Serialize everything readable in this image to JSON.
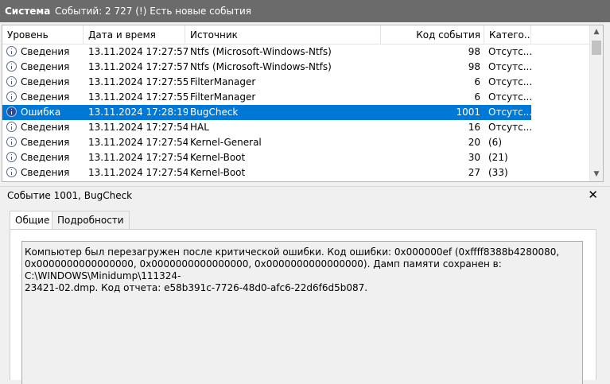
{
  "titlebar": {
    "title": "Система",
    "summary": "Событий: 2 727 (!) Есть новые события"
  },
  "columns": {
    "level": "Уровень",
    "datetime": "Дата и время",
    "source": "Источник",
    "event_id": "Код события",
    "category": "Катего..."
  },
  "rows": [
    {
      "level": "Сведения",
      "datetime": "13.11.2024 17:27:57",
      "source": "Ntfs (Microsoft-Windows-Ntfs)",
      "event_id": "98",
      "category": "Отсутс..."
    },
    {
      "level": "Сведения",
      "datetime": "13.11.2024 17:27:57",
      "source": "Ntfs (Microsoft-Windows-Ntfs)",
      "event_id": "98",
      "category": "Отсутс..."
    },
    {
      "level": "Сведения",
      "datetime": "13.11.2024 17:27:55",
      "source": "FilterManager",
      "event_id": "6",
      "category": "Отсутс..."
    },
    {
      "level": "Сведения",
      "datetime": "13.11.2024 17:27:55",
      "source": "FilterManager",
      "event_id": "6",
      "category": "Отсутс..."
    },
    {
      "level": "Ошибка",
      "datetime": "13.11.2024 17:28:19",
      "source": "BugCheck",
      "event_id": "1001",
      "category": "Отсутс...",
      "selected": true
    },
    {
      "level": "Сведения",
      "datetime": "13.11.2024 17:27:54",
      "source": "HAL",
      "event_id": "16",
      "category": "Отсутс..."
    },
    {
      "level": "Сведения",
      "datetime": "13.11.2024 17:27:54",
      "source": "Kernel-General",
      "event_id": "20",
      "category": "(6)"
    },
    {
      "level": "Сведения",
      "datetime": "13.11.2024 17:27:54",
      "source": "Kernel-Boot",
      "event_id": "30",
      "category": "(21)"
    },
    {
      "level": "Сведения",
      "datetime": "13.11.2024 17:27:54",
      "source": "Kernel-Boot",
      "event_id": "27",
      "category": "(33)"
    }
  ],
  "detail": {
    "title": "Событие 1001, BugCheck",
    "close_icon": "close-icon",
    "tabs": {
      "general": "Общие",
      "details": "Подробности"
    },
    "message_lines": [
      "Компьютер был перезагружен после критической ошибки.  Код ошибки: 0x000000ef (0xffff8388b4280080,",
      "0x0000000000000000, 0x0000000000000000, 0x0000000000000000). Дамп памяти сохранен в: C:\\WINDOWS\\Minidump\\111324-",
      "23421-02.dmp. Код отчета: e58b391c-7726-48d0-afc6-22d6f6d5b087."
    ]
  },
  "colors": {
    "selection": "#0078d7",
    "titlebar": "#6b6b6b"
  }
}
